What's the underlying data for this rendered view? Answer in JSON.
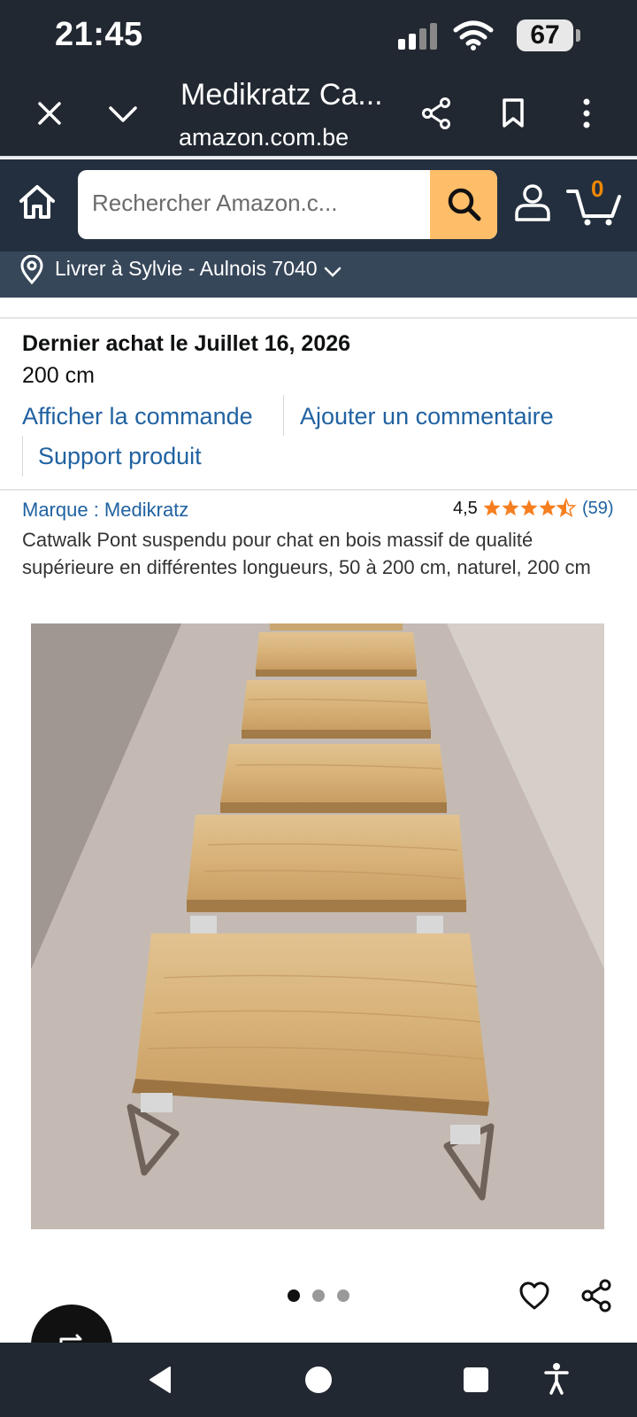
{
  "status_bar": {
    "time": "21:45",
    "battery": "67"
  },
  "browser": {
    "tab_title": "Medikratz Ca...",
    "url": "amazon.com.be",
    "icons": [
      "close-icon",
      "chevron-down-icon",
      "share-icon",
      "bookmark-icon",
      "more-icon"
    ]
  },
  "amazon_header": {
    "search_placeholder": "Rechercher Amazon.c...",
    "cart_count": "0",
    "delivery": "Livrer à Sylvie - Aulnois 7040"
  },
  "order": {
    "last_purchase": "Dernier achat le Juillet 16, 2026",
    "variant": "200 cm",
    "view_order": "Afficher la commande",
    "add_review": "Ajouter un commentaire",
    "product_support": "Support produit"
  },
  "product": {
    "brand": "Marque : Medikratz",
    "rating": "4,5",
    "rating_value": 4.5,
    "review_count": "(59)",
    "title": "Catwalk Pont suspendu pour chat en bois massif de qualité supérieure en différentes longueurs, 50 à 200 cm, naturel, 200 cm",
    "image_count": 3,
    "active_image": 1
  },
  "colors": {
    "header_dark": "#232f3e",
    "link_blue": "#2162a1",
    "search_button": "#febd69",
    "star_orange": "#ffa41c",
    "cart_count": "#f08804"
  }
}
